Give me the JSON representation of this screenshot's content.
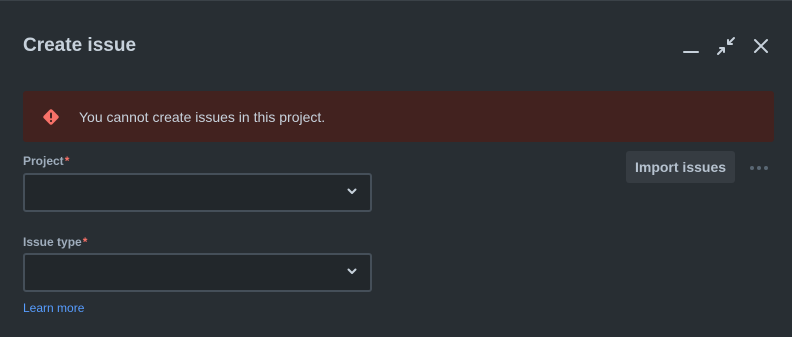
{
  "dialog": {
    "title": "Create issue"
  },
  "window_controls": {
    "minimize_icon": "minimize-icon",
    "collapse_icon": "collapse-icon",
    "close_icon": "close-icon"
  },
  "alert": {
    "icon": "error-icon",
    "message": "You cannot create issues in this project.",
    "color": "#f87168",
    "background": "#42221f"
  },
  "form": {
    "project": {
      "label": "Project",
      "required_marker": "*",
      "value": ""
    },
    "issue_type": {
      "label": "Issue type",
      "required_marker": "*",
      "value": ""
    },
    "learn_more": "Learn more"
  },
  "actions": {
    "import_label": "Import issues",
    "more_icon": "more-icon"
  },
  "colors": {
    "background": "#282e33",
    "text": "#c7d1db",
    "link": "#579dff",
    "required": "#f87168"
  }
}
